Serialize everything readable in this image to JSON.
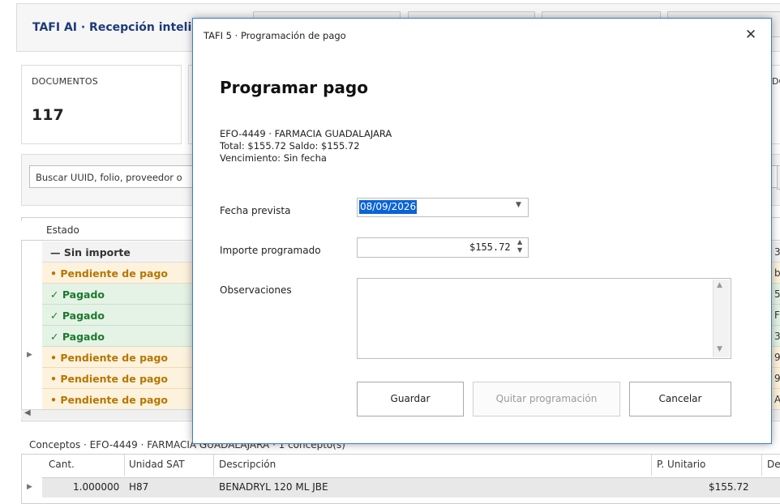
{
  "app": {
    "title": "TAFI AI · Recepción inteligente",
    "documents_label": "DOCUMENTOS",
    "documents_count": "117",
    "card_right_label": "DC",
    "search_placeholder": "Buscar UUID, folio, proveedor o",
    "grid_column_state": "Estado",
    "rows": [
      {
        "status": "— Sin importe",
        "kind": "none",
        "edge": "3"
      },
      {
        "status": "• Pendiente de pago",
        "kind": "pend",
        "edge": "b"
      },
      {
        "status": "✓  Pagado",
        "kind": "paid",
        "edge": "5"
      },
      {
        "status": "✓  Pagado",
        "kind": "paid",
        "edge": "F"
      },
      {
        "status": "✓  Pagado",
        "kind": "paid",
        "edge": "3"
      },
      {
        "status": "• Pendiente de pago",
        "kind": "pend",
        "edge": "9"
      },
      {
        "status": "• Pendiente de pago",
        "kind": "pend",
        "edge": "9"
      },
      {
        "status": "• Pendiente de pago",
        "kind": "pend",
        "edge": "A"
      }
    ],
    "concepts_label": "Conceptos · EFO-4449 · FARMACIA GUADALAJARA · 1 concepto(s)",
    "concepts_columns": {
      "qty": "Cant.",
      "unit": "Unidad SAT",
      "desc": "Descripción",
      "price": "P. Unitario",
      "extra": "De"
    },
    "concepts_row": {
      "qty": "1.000000",
      "unit": "H87",
      "desc": "BENADRYL 120 ML JBE",
      "price": "$155.72"
    }
  },
  "dialog": {
    "window_title": "TAFI 5 · Programación de pago",
    "close_glyph": "✕",
    "heading": "Programar pago",
    "info_line1": "EFO-4449 · FARMACIA GUADALAJARA",
    "info_line2": "Total: $155.72  Saldo: $155.72",
    "info_line3": "Vencimiento: Sin fecha",
    "date_label": "Fecha prevista",
    "date_value": "08/09/2026",
    "amount_label": "Importe programado",
    "amount_value": "$155.72",
    "notes_label": "Observaciones",
    "notes_value": "",
    "save_label": "Guardar",
    "remove_label": "Quitar programación",
    "cancel_label": "Cancelar"
  }
}
